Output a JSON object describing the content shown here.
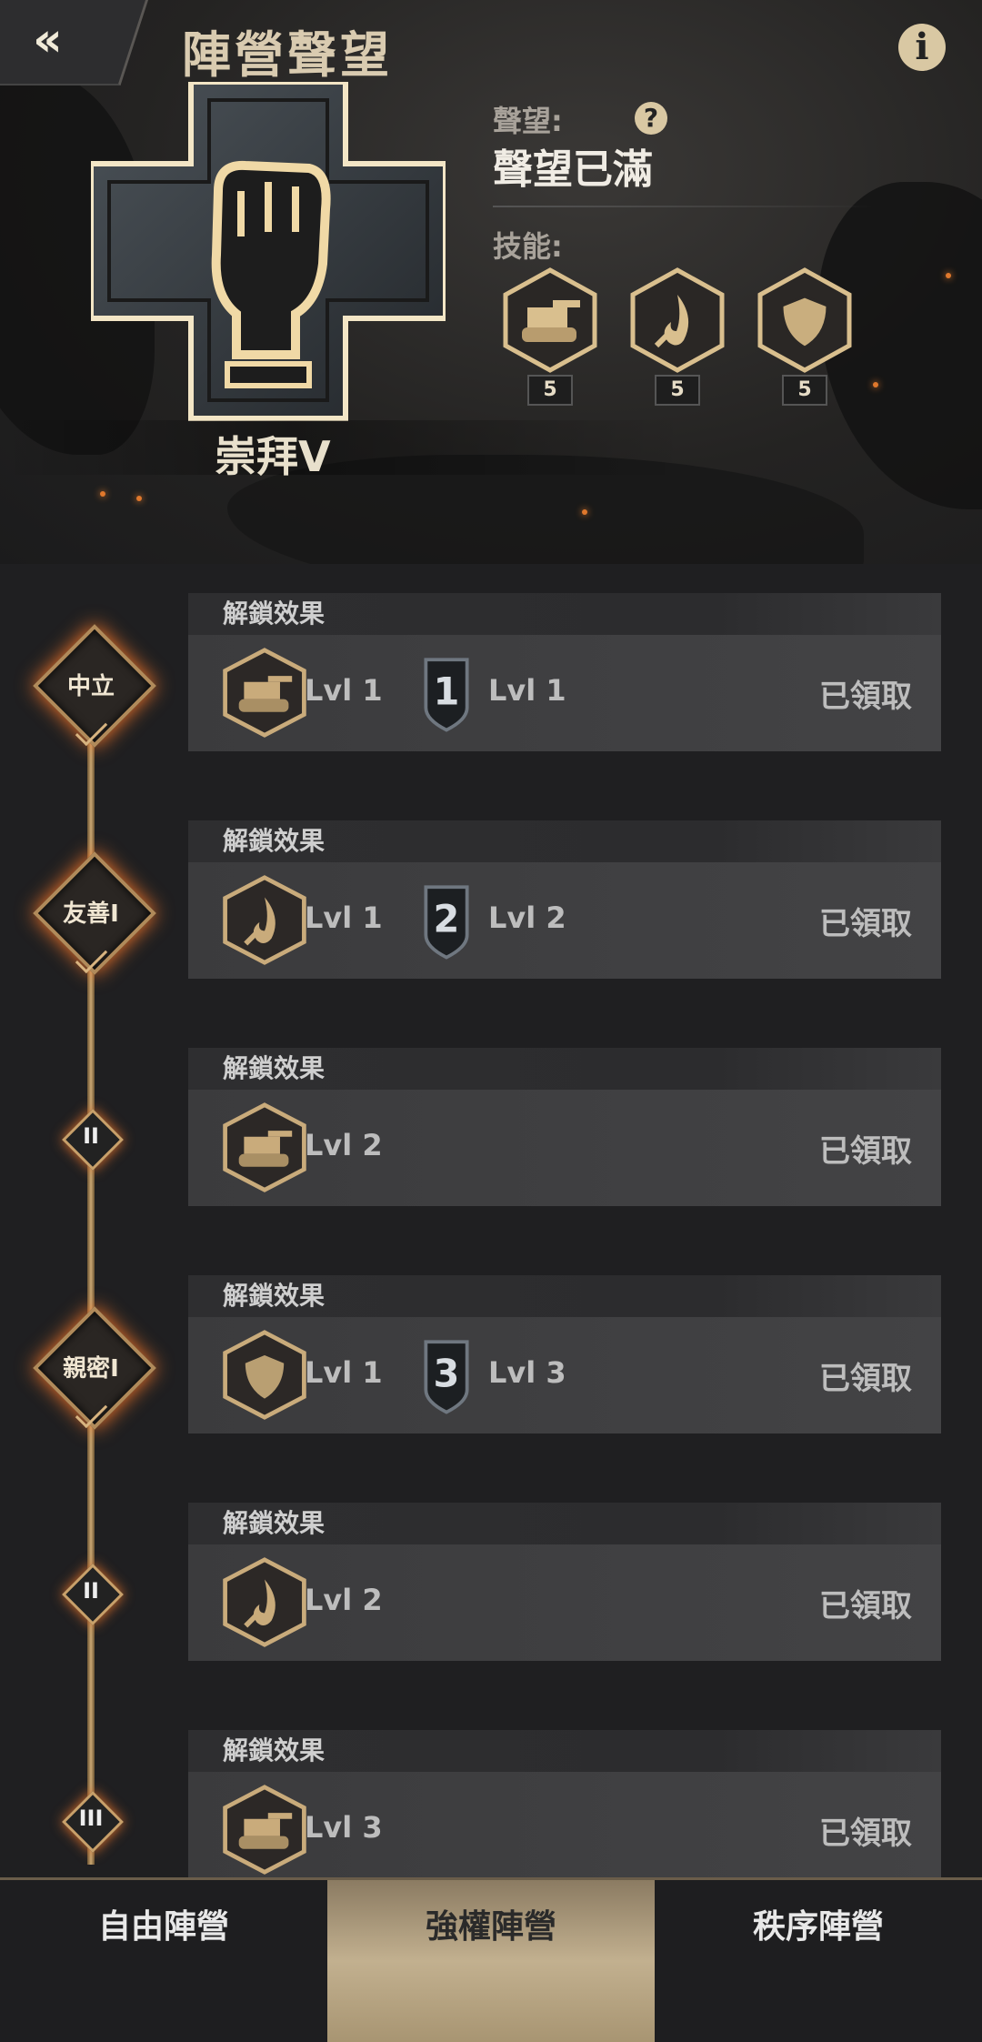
{
  "header": {
    "title": "陣營聲望",
    "back_icon": "double-chevron-left-icon",
    "info_icon": "info-icon"
  },
  "reputation": {
    "rank": "崇拜V",
    "label": "聲望:",
    "value": "聲望已滿",
    "skills_label": "技能:",
    "skills": [
      {
        "icon": "tank-icon",
        "level": "5"
      },
      {
        "icon": "fire-icon",
        "level": "5"
      },
      {
        "icon": "shield-icon",
        "level": "5"
      }
    ]
  },
  "milestones": [
    {
      "node": "中立",
      "node_type": "major",
      "heading": "解鎖效果",
      "skill_icon": "tank-icon",
      "skill_level": "Lvl 1",
      "badge": "1",
      "badge_level": "Lvl 1",
      "status": "已領取"
    },
    {
      "node": "友善I",
      "node_type": "major",
      "heading": "解鎖效果",
      "skill_icon": "fire-icon",
      "skill_level": "Lvl 1",
      "badge": "2",
      "badge_level": "Lvl 2",
      "status": "已領取"
    },
    {
      "node": "II",
      "node_type": "minor",
      "heading": "解鎖效果",
      "skill_icon": "tank-icon",
      "skill_level": "Lvl 2",
      "badge": "",
      "badge_level": "",
      "status": "已領取"
    },
    {
      "node": "親密I",
      "node_type": "major",
      "heading": "解鎖效果",
      "skill_icon": "shield-icon",
      "skill_level": "Lvl 1",
      "badge": "3",
      "badge_level": "Lvl 3",
      "status": "已領取"
    },
    {
      "node": "II",
      "node_type": "minor",
      "heading": "解鎖效果",
      "skill_icon": "fire-icon",
      "skill_level": "Lvl 2",
      "badge": "",
      "badge_level": "",
      "status": "已領取"
    },
    {
      "node": "III",
      "node_type": "minor",
      "heading": "解鎖效果",
      "skill_icon": "tank-icon",
      "skill_level": "Lvl 3",
      "badge": "",
      "badge_level": "",
      "status": "已領取"
    }
  ],
  "tabs": [
    {
      "label": "自由陣營",
      "active": false
    },
    {
      "label": "強權陣營",
      "active": true
    },
    {
      "label": "秩序陣營",
      "active": false
    }
  ],
  "colors": {
    "accent_gold": "#c9a773",
    "ember": "#e0782c",
    "active_tab": "#c2b08f"
  }
}
